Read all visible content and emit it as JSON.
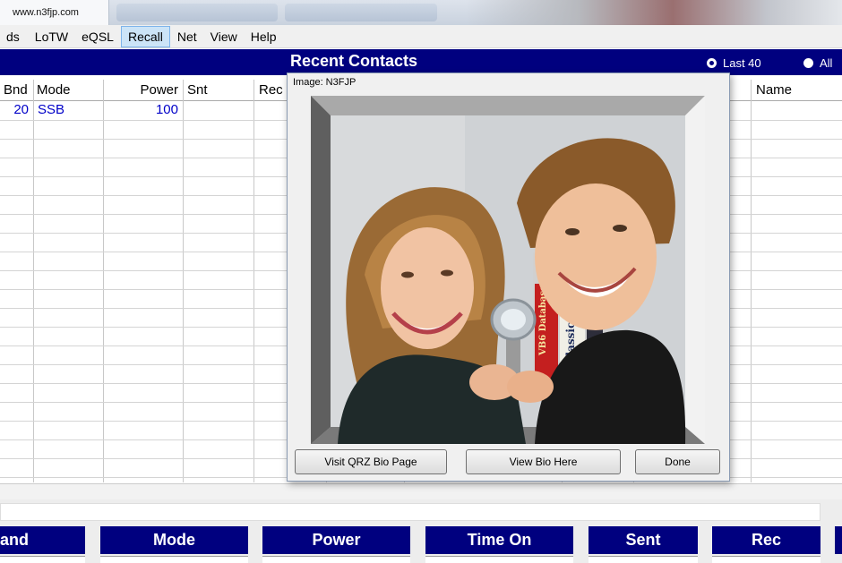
{
  "browser": {
    "url_tab": "www.n3fjp.com"
  },
  "menu": {
    "items": [
      {
        "label": "ds",
        "active": false
      },
      {
        "label": "LoTW",
        "active": false
      },
      {
        "label": "eQSL",
        "active": false
      },
      {
        "label": "Recall",
        "active": true
      },
      {
        "label": "Net",
        "active": false
      },
      {
        "label": "View",
        "active": false
      },
      {
        "label": "Help",
        "active": false
      }
    ]
  },
  "title_bar": {
    "title": "Recent Contacts",
    "filter_last": "Last 40",
    "filter_all": "All",
    "selected_filter": "Last 40"
  },
  "grid": {
    "headers": {
      "bnd": "Bnd",
      "mode": "Mode",
      "power": "Power",
      "snt": "Snt",
      "rec": "Rec",
      "name": "Name"
    },
    "rows": [
      {
        "bnd": "20",
        "mode": "SSB",
        "power": "100"
      }
    ]
  },
  "bottom_labels": [
    "and",
    "Mode",
    "Power",
    "Time On",
    "Sent",
    "Rec"
  ],
  "dialog": {
    "caption": "Image: N3FJP",
    "buttons": {
      "visit_qrz": "Visit QRZ Bio Page",
      "view_bio": "View Bio Here",
      "done": "Done"
    },
    "photo_books": {
      "book1": "VB6 Database",
      "book2": "Classics"
    }
  },
  "colors": {
    "header_blue": "#00007f",
    "data_text_blue": "#0000c8",
    "menu_highlight": "#cce4f7"
  }
}
